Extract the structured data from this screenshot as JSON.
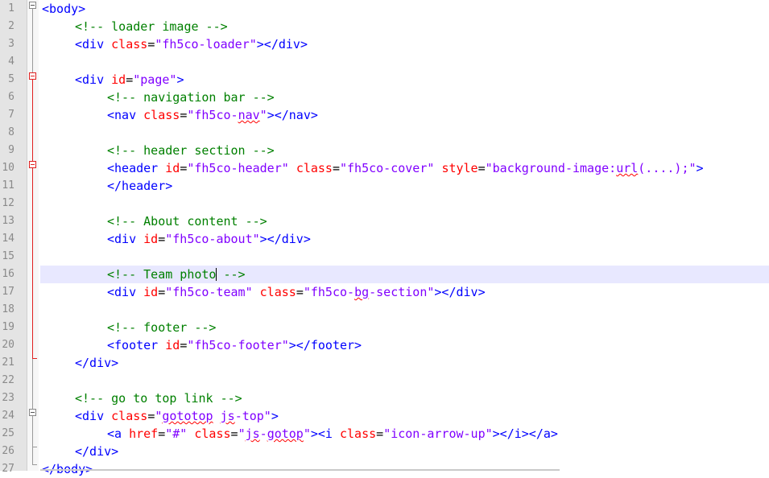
{
  "editor": {
    "current_line": 16,
    "lines": [
      {
        "n": "1",
        "tokens": [
          {
            "k": "t",
            "s": "<body>"
          }
        ]
      },
      {
        "n": "2",
        "tokens": [
          {
            "k": "c",
            "s": "<!-- loader image -->"
          }
        ]
      },
      {
        "n": "3",
        "tokens": [
          {
            "k": "t",
            "s": "<div "
          },
          {
            "k": "a",
            "s": "class"
          },
          {
            "k": "p",
            "s": "="
          },
          {
            "k": "v",
            "s": "\"fh5co-loader\""
          },
          {
            "k": "t",
            "s": "></div>"
          }
        ]
      },
      {
        "n": "4",
        "tokens": []
      },
      {
        "n": "5",
        "tokens": [
          {
            "k": "t",
            "s": "<div "
          },
          {
            "k": "a",
            "s": "id"
          },
          {
            "k": "p",
            "s": "="
          },
          {
            "k": "v",
            "s": "\"page\""
          },
          {
            "k": "t",
            "s": ">"
          }
        ]
      },
      {
        "n": "6",
        "tokens": [
          {
            "k": "c",
            "s": "<!-- navigation bar -->"
          }
        ]
      },
      {
        "n": "7",
        "tokens": [
          {
            "k": "t",
            "s": "<nav "
          },
          {
            "k": "a",
            "s": "class"
          },
          {
            "k": "p",
            "s": "="
          },
          {
            "k": "v",
            "s": "\"fh5co-"
          },
          {
            "k": "v",
            "s": "nav",
            "sq": true
          },
          {
            "k": "v",
            "s": "\""
          },
          {
            "k": "t",
            "s": "></nav>"
          }
        ]
      },
      {
        "n": "8",
        "tokens": []
      },
      {
        "n": "9",
        "tokens": [
          {
            "k": "c",
            "s": "<!-- header section -->"
          }
        ]
      },
      {
        "n": "10",
        "tokens": [
          {
            "k": "t",
            "s": "<header "
          },
          {
            "k": "a",
            "s": "id"
          },
          {
            "k": "p",
            "s": "="
          },
          {
            "k": "v",
            "s": "\"fh5co-header\""
          },
          {
            "k": "t",
            "s": " "
          },
          {
            "k": "a",
            "s": "class"
          },
          {
            "k": "p",
            "s": "="
          },
          {
            "k": "v",
            "s": "\"fh5co-cover\""
          },
          {
            "k": "t",
            "s": " "
          },
          {
            "k": "a",
            "s": "style"
          },
          {
            "k": "p",
            "s": "="
          },
          {
            "k": "v",
            "s": "\"background-image:"
          },
          {
            "k": "v",
            "s": "url",
            "sq": true
          },
          {
            "k": "v",
            "s": "(....);\""
          },
          {
            "k": "t",
            "s": ">"
          }
        ]
      },
      {
        "n": "11",
        "tokens": [
          {
            "k": "t",
            "s": "</header>"
          }
        ]
      },
      {
        "n": "12",
        "tokens": []
      },
      {
        "n": "13",
        "tokens": [
          {
            "k": "c",
            "s": "<!-- About content -->"
          }
        ]
      },
      {
        "n": "14",
        "tokens": [
          {
            "k": "t",
            "s": "<div "
          },
          {
            "k": "a",
            "s": "id"
          },
          {
            "k": "p",
            "s": "="
          },
          {
            "k": "v",
            "s": "\"fh5co-about\""
          },
          {
            "k": "t",
            "s": "></div>"
          }
        ]
      },
      {
        "n": "15",
        "tokens": []
      },
      {
        "n": "16",
        "tokens": [
          {
            "k": "c",
            "s": "<!-- Team photo"
          },
          {
            "k": "caret"
          },
          {
            "k": "c",
            "s": " -->"
          }
        ]
      },
      {
        "n": "17",
        "tokens": [
          {
            "k": "t",
            "s": "<div "
          },
          {
            "k": "a",
            "s": "id"
          },
          {
            "k": "p",
            "s": "="
          },
          {
            "k": "v",
            "s": "\"fh5co-team\""
          },
          {
            "k": "t",
            "s": " "
          },
          {
            "k": "a",
            "s": "class"
          },
          {
            "k": "p",
            "s": "="
          },
          {
            "k": "v",
            "s": "\"fh5co-"
          },
          {
            "k": "v",
            "s": "bg",
            "sq": true
          },
          {
            "k": "v",
            "s": "-section\""
          },
          {
            "k": "t",
            "s": "></div>"
          }
        ]
      },
      {
        "n": "18",
        "tokens": []
      },
      {
        "n": "19",
        "tokens": [
          {
            "k": "c",
            "s": "<!-- footer -->"
          }
        ]
      },
      {
        "n": "20",
        "tokens": [
          {
            "k": "t",
            "s": "<footer "
          },
          {
            "k": "a",
            "s": "id"
          },
          {
            "k": "p",
            "s": "="
          },
          {
            "k": "v",
            "s": "\"fh5co-footer\""
          },
          {
            "k": "t",
            "s": "></footer>"
          }
        ]
      },
      {
        "n": "21",
        "tokens": [
          {
            "k": "t",
            "s": "</div>"
          }
        ]
      },
      {
        "n": "22",
        "tokens": []
      },
      {
        "n": "23",
        "tokens": [
          {
            "k": "c",
            "s": "<!-- go to top link -->"
          }
        ]
      },
      {
        "n": "24",
        "tokens": [
          {
            "k": "t",
            "s": "<div "
          },
          {
            "k": "a",
            "s": "class"
          },
          {
            "k": "p",
            "s": "="
          },
          {
            "k": "v",
            "s": "\""
          },
          {
            "k": "v",
            "s": "gototop",
            "sq": true
          },
          {
            "k": "v",
            "s": " "
          },
          {
            "k": "v",
            "s": "js",
            "sq": true
          },
          {
            "k": "v",
            "s": "-top\""
          },
          {
            "k": "t",
            "s": ">"
          }
        ]
      },
      {
        "n": "25",
        "tokens": [
          {
            "k": "t",
            "s": "<a "
          },
          {
            "k": "a",
            "s": "href"
          },
          {
            "k": "p",
            "s": "="
          },
          {
            "k": "v",
            "s": "\"#\""
          },
          {
            "k": "t",
            "s": " "
          },
          {
            "k": "a",
            "s": "class"
          },
          {
            "k": "p",
            "s": "="
          },
          {
            "k": "v",
            "s": "\""
          },
          {
            "k": "v",
            "s": "js",
            "sq": true
          },
          {
            "k": "v",
            "s": "-"
          },
          {
            "k": "v",
            "s": "gotop",
            "sq": true
          },
          {
            "k": "v",
            "s": "\""
          },
          {
            "k": "t",
            "s": "><i "
          },
          {
            "k": "a",
            "s": "class"
          },
          {
            "k": "p",
            "s": "="
          },
          {
            "k": "v",
            "s": "\"icon-arrow-up\""
          },
          {
            "k": "t",
            "s": "></i></a>"
          }
        ]
      },
      {
        "n": "26",
        "tokens": [
          {
            "k": "t",
            "s": "</div>"
          }
        ]
      },
      {
        "n": "27",
        "tokens": [
          {
            "k": "t",
            "s": "</body>"
          }
        ]
      }
    ]
  },
  "colors": {
    "tag": "#0000ff",
    "attribute": "#ff0000",
    "value": "#8000ff",
    "comment": "#008000",
    "line_number": "#8a8a8a",
    "gutter": "#e4e4e4",
    "current_line": "#e8e8ff",
    "fold_marker": "#e02020",
    "squiggle": "#ff0000"
  }
}
